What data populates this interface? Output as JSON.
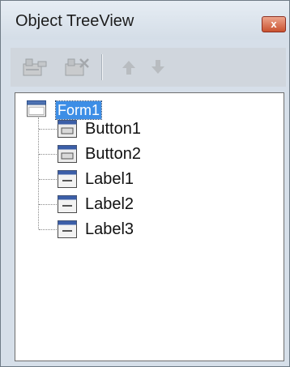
{
  "panel": {
    "title": "Object TreeView",
    "close_label": "x"
  },
  "toolbar": {
    "buttons": [
      {
        "name": "add-component",
        "icon": "component-add-icon",
        "enabled": false
      },
      {
        "name": "remove-component",
        "icon": "component-remove-icon",
        "enabled": false
      },
      {
        "name": "move-up",
        "icon": "arrow-up-icon",
        "enabled": false
      },
      {
        "name": "move-down",
        "icon": "arrow-down-icon",
        "enabled": false
      }
    ]
  },
  "tree": {
    "root": {
      "label": "Form1",
      "icon": "form-icon",
      "selected": true
    },
    "children": [
      {
        "label": "Button1",
        "icon": "button-component-icon"
      },
      {
        "label": "Button2",
        "icon": "button-component-icon"
      },
      {
        "label": "Label1",
        "icon": "label-component-icon"
      },
      {
        "label": "Label2",
        "icon": "label-component-icon"
      },
      {
        "label": "Label3",
        "icon": "label-component-icon"
      }
    ]
  },
  "colors": {
    "selection": "#3d8ee6",
    "panel_background": "#d6dfe9",
    "close_button": "#c9522f"
  }
}
